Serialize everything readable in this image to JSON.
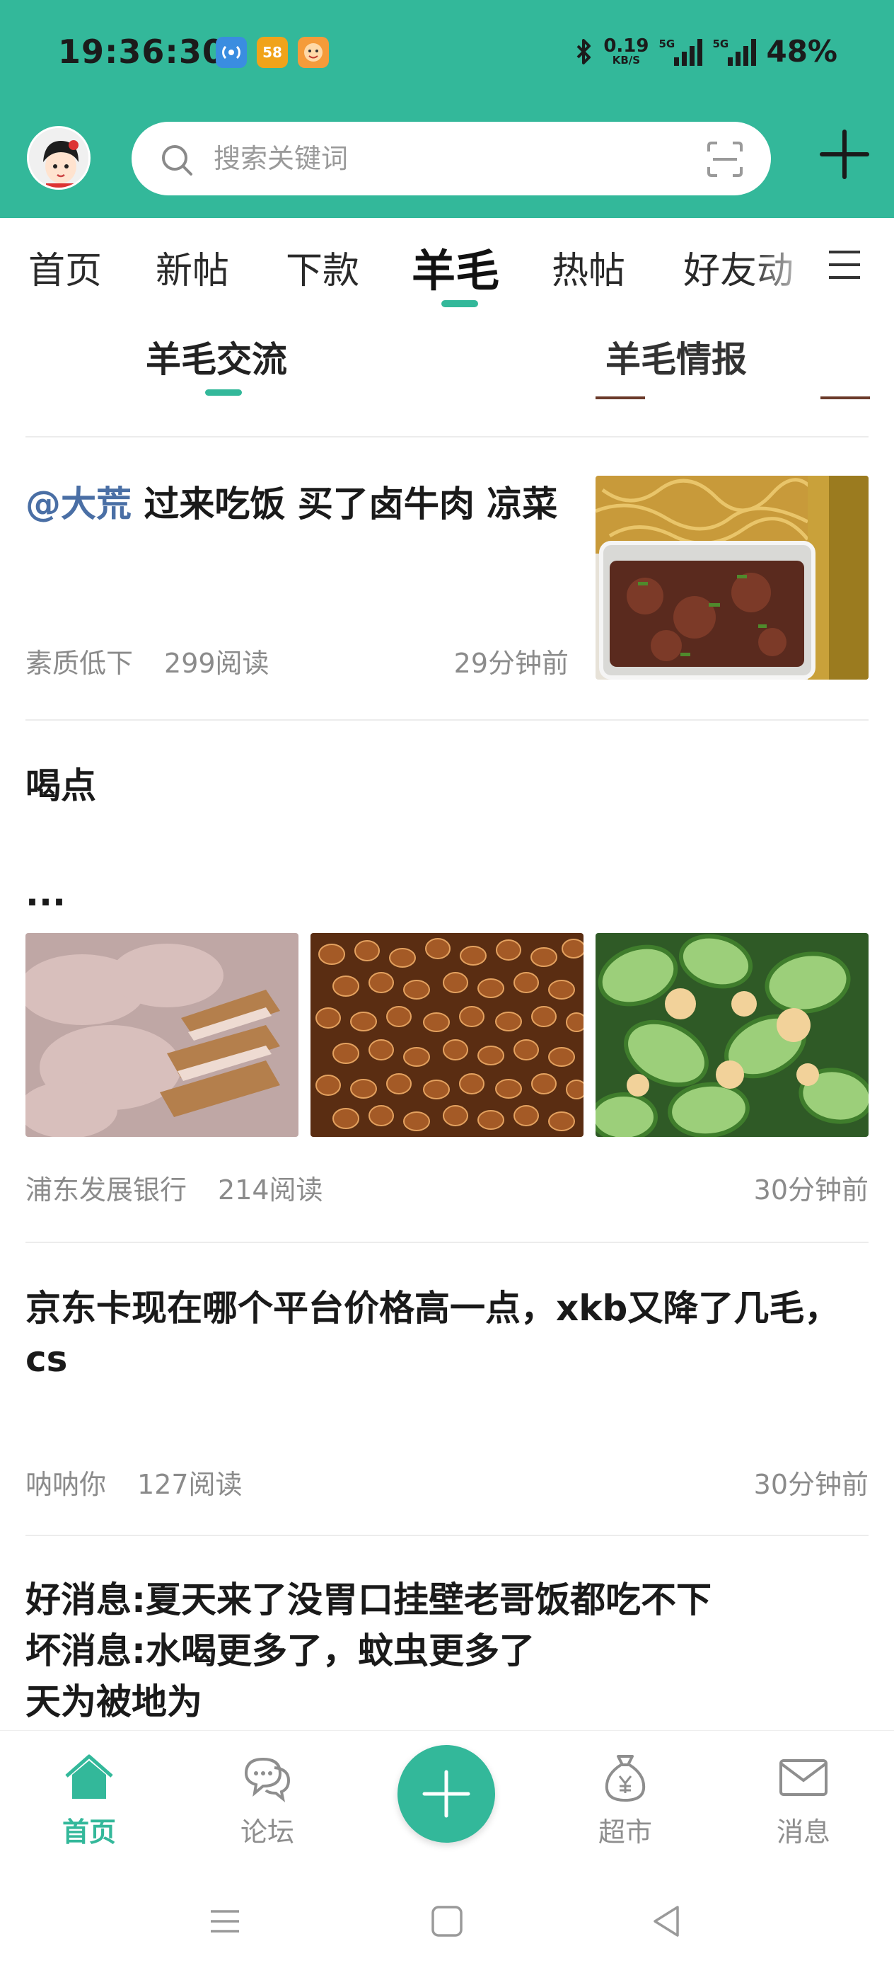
{
  "status_bar": {
    "time": "19:36:30",
    "app_badges": [
      {
        "icon": "hotspot-app-icon",
        "color": "#3a8de0",
        "label": ""
      },
      {
        "icon": "58-app-icon",
        "color": "#f0a31a",
        "label": "58"
      },
      {
        "icon": "cartoon-app-icon",
        "color": "#f59b3a",
        "label": ""
      }
    ],
    "net_speed_value": "0.19",
    "net_speed_unit": "KB/S",
    "signal_1_label": "5G",
    "signal_2_label": "5G",
    "battery": "48%"
  },
  "header": {
    "search_placeholder": "搜索关键词",
    "accent_color": "#33b89a"
  },
  "category_tabs": [
    {
      "label": "首页",
      "active": false
    },
    {
      "label": "新帖",
      "active": false
    },
    {
      "label": "下款",
      "active": false
    },
    {
      "label": "羊毛",
      "active": true
    },
    {
      "label": "热帖",
      "active": false
    },
    {
      "label": "好友动",
      "active": false
    }
  ],
  "sub_tabs": [
    {
      "label": "羊毛交流",
      "active": true
    },
    {
      "label": "羊毛情报",
      "active": false
    }
  ],
  "posts": [
    {
      "mention": "@大荒",
      "title": " 过来吃饭 买了卤牛肉 凉菜",
      "author": "素质低下",
      "reads": "299阅读",
      "time": "29分钟前",
      "images": [
        "beef-and-cold-dish-photo"
      ]
    },
    {
      "title": "喝点",
      "excerpt": "...",
      "author": "浦东发展银行",
      "reads": "214阅读",
      "time": "30分钟前",
      "images": [
        "sliced-pork-photo",
        "fried-peanuts-photo",
        "cucumber-egg-photo"
      ]
    },
    {
      "title": "京东卡现在哪个平台价格高一点，xkb又降了几毛，cs",
      "author": "呐呐你",
      "reads": "127阅读",
      "time": "30分钟前"
    },
    {
      "title_lines": [
        "好消息:夏天来了没胃口挂壁老哥饭都吃不下",
        "坏消息:水喝更多了，蚊虫更多了",
        "天为被地为"
      ]
    }
  ],
  "bottom_nav": [
    {
      "label": "首页",
      "icon": "home-icon",
      "active": true
    },
    {
      "label": "论坛",
      "icon": "chat-bubbles-icon",
      "active": false
    },
    {
      "label": "",
      "icon": "plus-icon",
      "active": false
    },
    {
      "label": "超市",
      "icon": "money-bag-icon",
      "active": false
    },
    {
      "label": "消息",
      "icon": "envelope-icon",
      "active": false
    }
  ]
}
